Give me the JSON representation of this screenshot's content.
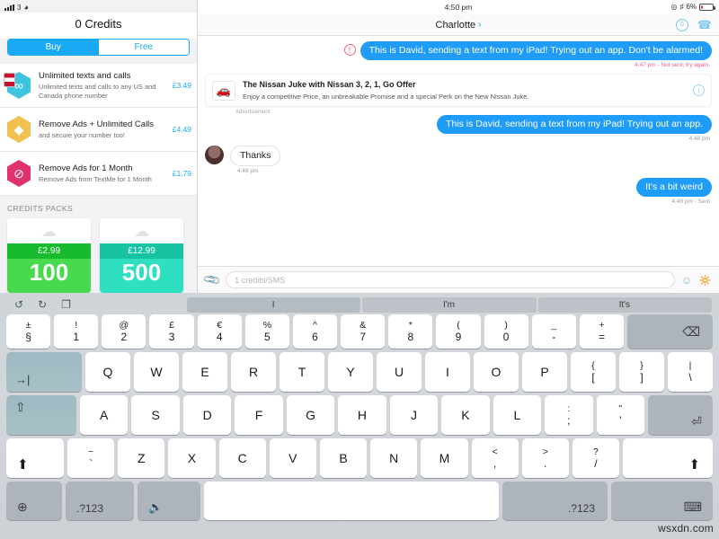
{
  "left_panel": {
    "status": {
      "signal": "signal-bars",
      "carrier_number": "3",
      "wifi": "wifi-icon"
    },
    "title": "0 Credits",
    "segments": [
      {
        "label": "Buy",
        "selected": true
      },
      {
        "label": "Free",
        "selected": false
      }
    ],
    "iap_items": [
      {
        "title": "Unlimited texts and calls",
        "subtitle": "Unlimited texts and calls to any US and Canada phone number",
        "price": "£3.49",
        "icon": "infinity-icon"
      },
      {
        "title": "Remove Ads + Unlimited Calls",
        "subtitle": "and secure your number too!",
        "price": "£4.49",
        "icon": "diamond-icon"
      },
      {
        "title": "Remove Ads for 1 Month",
        "subtitle": "Remove Ads from TextMe for 1 Month",
        "price": "£1.79",
        "icon": "no-entry-icon"
      }
    ],
    "packs_header": "CREDITS PACKS",
    "packs": [
      {
        "price": "£2.99",
        "amount": "100",
        "icon": "cloud-icon"
      },
      {
        "price": "£12.99",
        "amount": "500",
        "icon": "cloud-icon"
      }
    ]
  },
  "chat": {
    "status": {
      "time": "4:50 pm",
      "battery_percent": "6%",
      "bluetooth": "bluetooth-icon",
      "lock": "orientation-lock-icon"
    },
    "nav": {
      "title": "Charlotte",
      "chevron": "›",
      "credits_badge": "0",
      "call_icon": "phone-icon"
    },
    "messages": [
      {
        "type": "outgoing-error",
        "text": "This is David, sending a text from my iPad! Trying out an app. Don't be alarmed!",
        "meta": "4:47 pm - Not sent, try again."
      },
      {
        "type": "ad",
        "title": "The Nissan Juke with Nissan 3, 2, 1, Go Offer",
        "desc": "Enjoy a competitive Price, an unbreakable Promise and a special Perk on the New Nissan Juke.",
        "label": "Advertisement",
        "icon": "car-icon",
        "action_icon": "download-icon"
      },
      {
        "type": "outgoing",
        "text": "This is David, sending a text from my iPad! Trying out an app.",
        "meta": "4:48 pm"
      },
      {
        "type": "incoming",
        "text": "Thanks",
        "meta": "4:48 pm",
        "avatar": "contact-avatar"
      },
      {
        "type": "outgoing",
        "text": "It's a bit weird",
        "meta": "4:49 pm - Sent"
      }
    ],
    "composer": {
      "attach_icon": "paperclip-icon",
      "placeholder": "1 credits/SMS",
      "emoji_icon": "smiley-icon",
      "mic_icon": "microphone-icon"
    }
  },
  "keyboard": {
    "tools": [
      {
        "name": "undo-icon",
        "glyph": "↺"
      },
      {
        "name": "redo-icon",
        "glyph": "↻"
      },
      {
        "name": "paste-icon",
        "glyph": "❐"
      }
    ],
    "predictions": [
      "I",
      "I'm",
      "It's"
    ],
    "row_numbers": [
      {
        "up": "±",
        "lo": "§"
      },
      {
        "up": "!",
        "lo": "1"
      },
      {
        "up": "@",
        "lo": "2"
      },
      {
        "up": "£",
        "lo": "3"
      },
      {
        "up": "€",
        "lo": "4"
      },
      {
        "up": "%",
        "lo": "5"
      },
      {
        "up": "^",
        "lo": "6"
      },
      {
        "up": "&",
        "lo": "7"
      },
      {
        "up": "*",
        "lo": "8"
      },
      {
        "up": "(",
        "lo": "9"
      },
      {
        "up": ")",
        "lo": "0"
      },
      {
        "up": "_",
        "lo": "-"
      },
      {
        "up": "+",
        "lo": "="
      }
    ],
    "backspace": "⌫",
    "tab": "→|",
    "row_top": [
      "Q",
      "W",
      "E",
      "R",
      "T",
      "Y",
      "U",
      "I",
      "O",
      "P"
    ],
    "row_top_extra": [
      {
        "up": "{",
        "lo": "["
      },
      {
        "up": "}",
        "lo": "]"
      },
      {
        "up": "|",
        "lo": "\\"
      }
    ],
    "caps": "⇧",
    "row_home": [
      "A",
      "S",
      "D",
      "F",
      "G",
      "H",
      "J",
      "K",
      "L"
    ],
    "row_home_extra": [
      {
        "up": ":",
        "lo": ";"
      },
      {
        "up": "\"",
        "lo": "'"
      }
    ],
    "return": "⏎",
    "shift_left": "⬆",
    "tilde": {
      "up": "~",
      "lo": "`"
    },
    "row_bottom": [
      "Z",
      "X",
      "C",
      "V",
      "B",
      "N",
      "M"
    ],
    "row_bottom_extra": [
      {
        "up": "<",
        "lo": ","
      },
      {
        "up": ">",
        "lo": "."
      },
      {
        "up": "?",
        "lo": "/"
      }
    ],
    "shift_right": "⬆",
    "globe": "⊕",
    "num_left": ".?123",
    "mic": "🎤",
    "space": "",
    "num_right": ".?123",
    "hide_keyboard": "⌨"
  },
  "watermark": "wsxdn.com"
}
